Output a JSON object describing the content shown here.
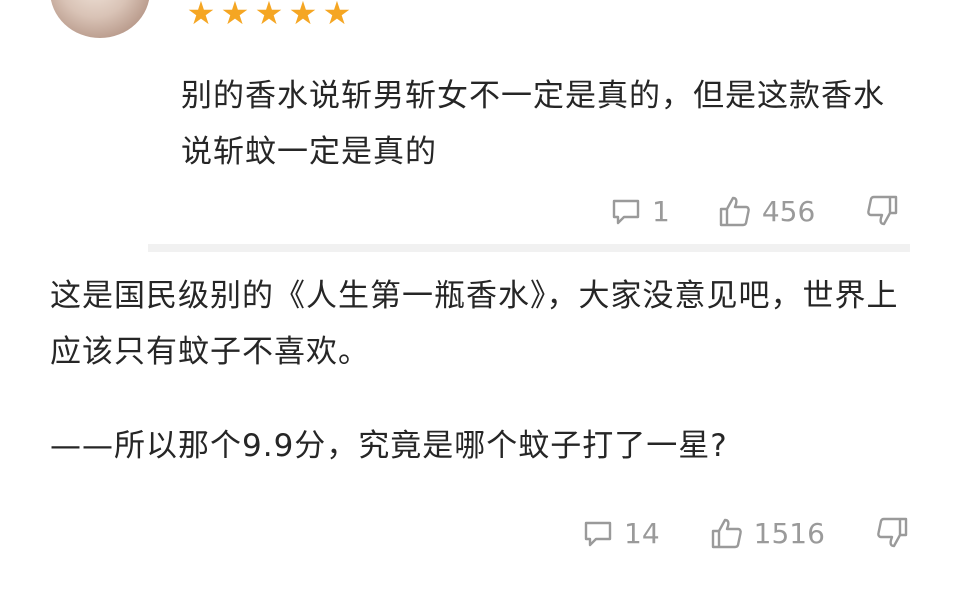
{
  "review": {
    "rating": 5,
    "stars": [
      "★",
      "★",
      "★",
      "★",
      "★"
    ],
    "text": "别的香水说斩男斩女不一定是真的，但是这款香水说斩蚊一定是真的",
    "comments": "1",
    "likes": "456"
  },
  "post": {
    "text": "这是国民级别的《人生第一瓶香水》，大家没意见吧，世界上应该只有蚊子不喜欢。",
    "followup": "——所以那个9.9分，究竟是哪个蚊子打了一星?",
    "comments": "14",
    "likes": "1516"
  },
  "colors": {
    "star": "#f5a623",
    "icon": "#9a9a9a",
    "text": "#262626"
  }
}
